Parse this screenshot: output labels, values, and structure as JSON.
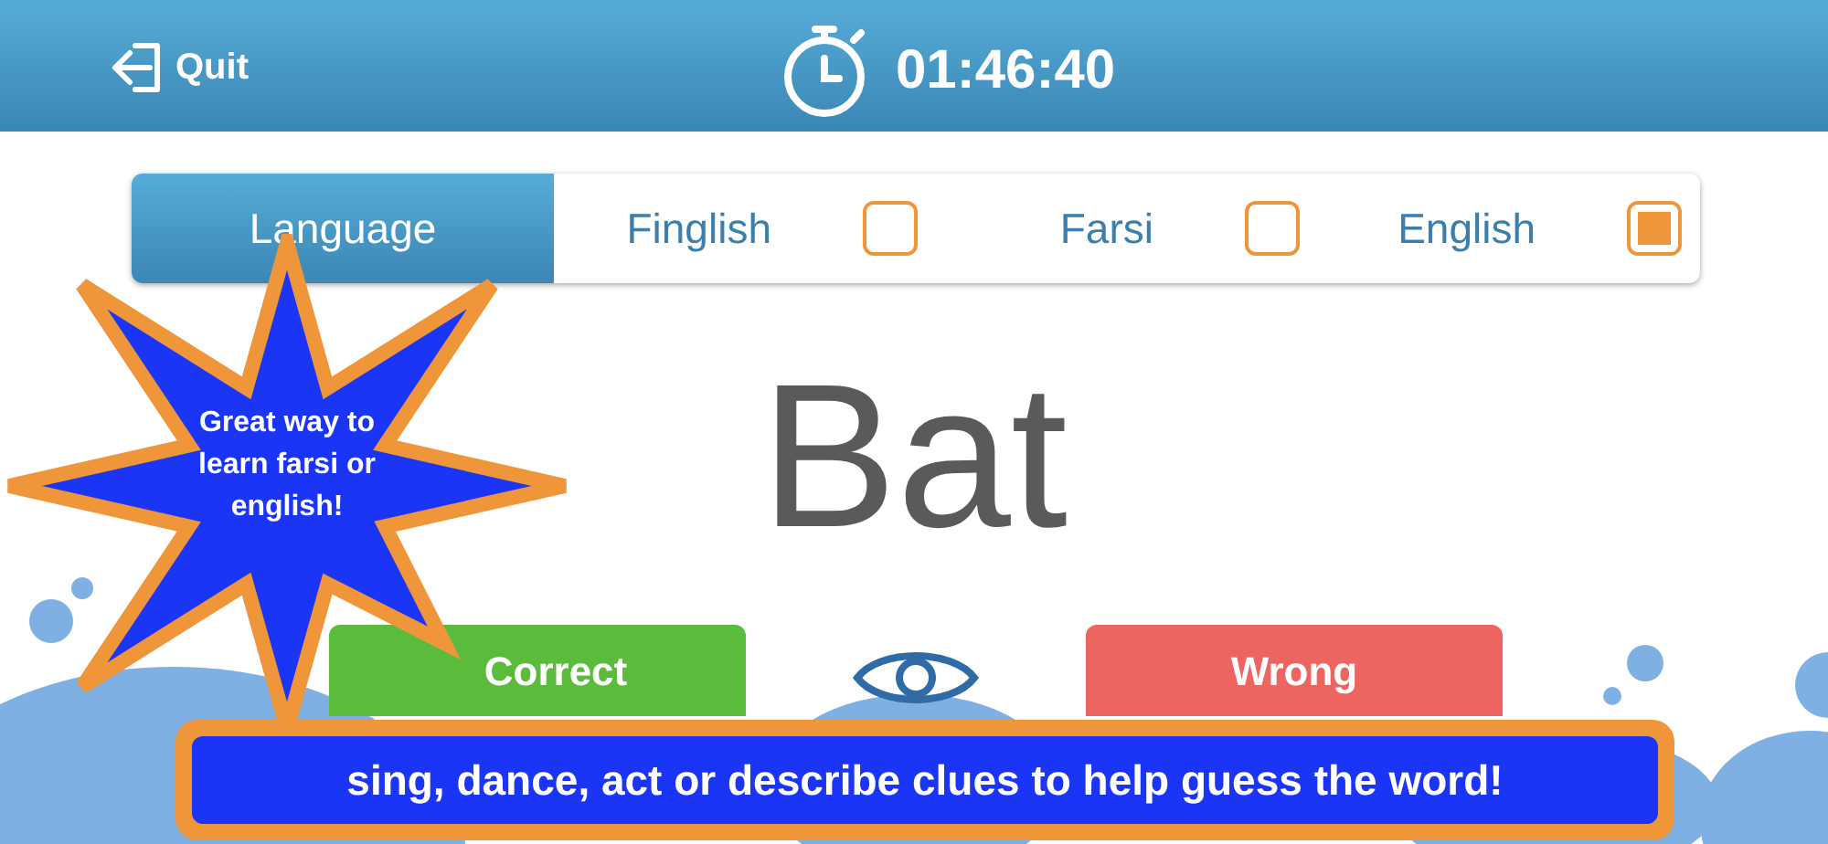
{
  "header": {
    "quit_label": "Quit",
    "timer": "01:46:40"
  },
  "language_bar": {
    "label": "Language",
    "options": [
      {
        "label": "Finglish",
        "checked": false
      },
      {
        "label": "Farsi",
        "checked": false
      },
      {
        "label": "English",
        "checked": true
      }
    ]
  },
  "word": "Bat",
  "buttons": [
    {
      "kind": "correct",
      "label": "Correct"
    },
    {
      "kind": "wrong",
      "label": "Wrong"
    }
  ],
  "promo_star": {
    "text": "Great way to learn farsi or english!"
  },
  "promo_banner": {
    "text": "sing, dance, act or describe clues to help guess the word!"
  }
}
